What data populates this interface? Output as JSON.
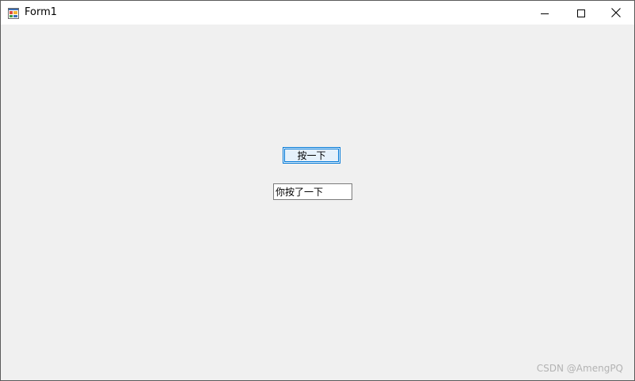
{
  "window": {
    "title": "Form1",
    "app_icon": "winforms-app-icon",
    "controls": {
      "minimize_icon": "minimize-icon",
      "maximize_icon": "maximize-icon",
      "close_icon": "close-icon"
    }
  },
  "form": {
    "button_label": "按一下",
    "textbox_value": "你按了一下"
  },
  "watermark": "CSDN @AmengPQ",
  "colors": {
    "client_background": "#f0f0f0",
    "titlebar_background": "#ffffff",
    "button_accent": "#0078d7",
    "button_fill": "#e5f1fb"
  }
}
